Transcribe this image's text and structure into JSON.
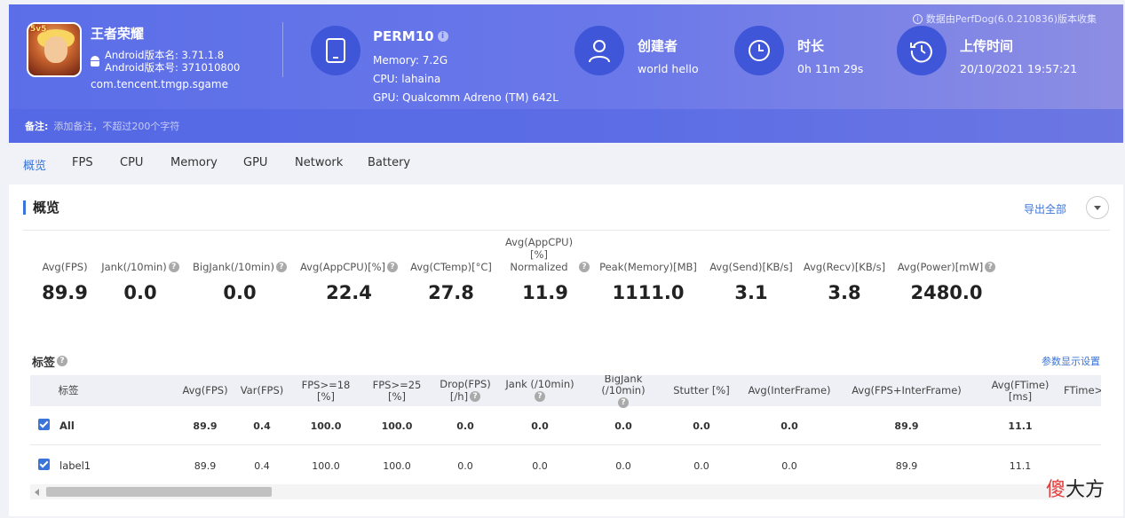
{
  "notice": "数据由PerfDog(6.0.210836)版本收集",
  "app": {
    "name": "王者荣耀",
    "version_name": "Android版本名: 3.71.1.8",
    "version_code": "Android版本号: 371010800",
    "package": "com.tencent.tmgp.sgame",
    "icon_badge": "5v5"
  },
  "device": {
    "model": "PERM10",
    "memory": "Memory: 7.2G",
    "cpu": "CPU: lahaina",
    "gpu": "GPU: Qualcomm Adreno (TM) 642L"
  },
  "creator": {
    "label": "创建者",
    "value": "world hello"
  },
  "duration": {
    "label": "时长",
    "value": "0h 11m 29s"
  },
  "upload": {
    "label": "上传时间",
    "value": "20/10/2021 19:57:21"
  },
  "remark": {
    "label": "备注:",
    "placeholder": "添加备注，不超过200个字符"
  },
  "tabs": [
    "概览",
    "FPS",
    "CPU",
    "Memory",
    "GPU",
    "Network",
    "Battery"
  ],
  "overview": {
    "title": "概览",
    "export_label": "导出全部",
    "metrics": [
      {
        "label": "Avg(FPS)",
        "value": "89.9"
      },
      {
        "label": "Jank(/10min)",
        "value": "0.0"
      },
      {
        "label": "BigJank(/10min)",
        "value": "0.0"
      },
      {
        "label": "Avg(AppCPU)[%]",
        "value": "22.4"
      },
      {
        "label": "Avg(CTemp)[°C]",
        "value": "27.8"
      },
      {
        "label": "Avg(AppCPU)[%]",
        "label2": "Normalized",
        "value": "11.9"
      },
      {
        "label": "Peak(Memory)[MB]",
        "value": "1111.0"
      },
      {
        "label": "Avg(Send)[KB/s]",
        "value": "3.1"
      },
      {
        "label": "Avg(Recv)[KB/s]",
        "value": "3.8"
      },
      {
        "label": "Avg(Power)[mW]",
        "value": "2480.0"
      }
    ]
  },
  "tags": {
    "title": "标签",
    "param_link": "参数显示设置",
    "columns": [
      "标签",
      "Avg(FPS)",
      "Var(FPS)",
      "FPS>=18 [%]",
      "FPS>=25 [%]",
      "Drop(FPS)",
      "[/h]",
      "Jank (/10min)",
      "BigJank (/10min)",
      "Stutter [%]",
      "Avg(InterFrame)",
      "Avg(FPS+InterFrame)",
      "Avg(FTime)",
      "[ms]",
      "FTime>"
    ],
    "rows": [
      {
        "label": "All",
        "values": [
          "89.9",
          "0.4",
          "100.0",
          "100.0",
          "0.0",
          "0.0",
          "0.0",
          "0.0",
          "0.0",
          "89.9",
          "11.1"
        ]
      },
      {
        "label": "label1",
        "values": [
          "89.9",
          "0.4",
          "100.0",
          "100.0",
          "0.0",
          "0.0",
          "0.0",
          "0.0",
          "0.0",
          "89.9",
          "11.1"
        ]
      }
    ]
  },
  "watermark": {
    "part1": "傻",
    "part2": "大方"
  }
}
